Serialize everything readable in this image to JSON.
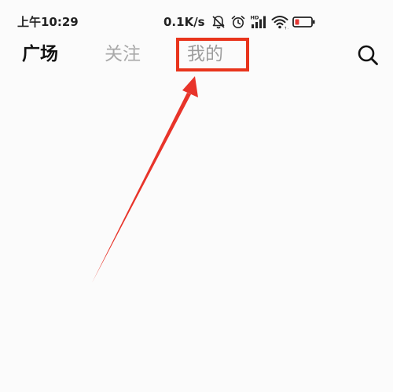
{
  "status_bar": {
    "time": "上午10:29",
    "net_speed": "0.1K/s",
    "icons": [
      "mute-bell-icon",
      "alarm-icon",
      "hd-signal-icon",
      "wifi-icon",
      "battery-icon"
    ]
  },
  "tabs": [
    {
      "label": "广场",
      "state": "active"
    },
    {
      "label": "关注",
      "state": "inactive"
    },
    {
      "label": "我的",
      "state": "highlighted"
    }
  ],
  "search": {
    "icon": "search-icon"
  },
  "annotation": {
    "color": "#e8341c",
    "shape": "box-with-arrow",
    "target": "我的"
  },
  "colors": {
    "background": "#fbfbfb",
    "active_text": "#111111",
    "inactive_text": "#a9a9a9"
  }
}
